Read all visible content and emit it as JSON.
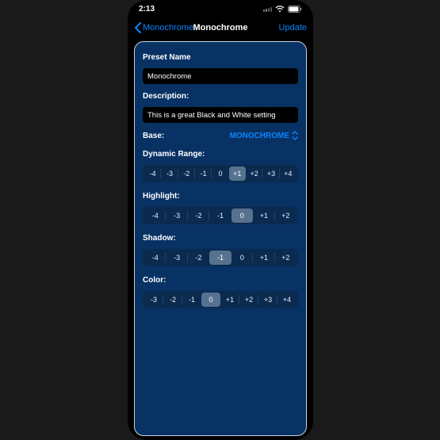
{
  "status": {
    "time": "2:13"
  },
  "nav": {
    "back_label": "Monochrome",
    "title": "Monochrome",
    "action": "Update"
  },
  "labels": {
    "preset_name": "Preset Name",
    "description": "Description:",
    "base": "Base:",
    "dynamic_range": "Dynamic Range:",
    "highlight": "Highlight:",
    "shadow": "Shadow:",
    "color": "Color:"
  },
  "fields": {
    "preset_name": "Monochrome",
    "description": "This is a great Black and White setting"
  },
  "base": {
    "value": "MONOCHROME"
  },
  "dynamic_range": {
    "options": [
      "-4",
      "-3",
      "-2",
      "-1",
      "0",
      "+1",
      "+2",
      "+3",
      "+4"
    ],
    "selected": "+1"
  },
  "highlight": {
    "options": [
      "-4",
      "-3",
      "-2",
      "-1",
      "0",
      "+1",
      "+2"
    ],
    "selected": "0"
  },
  "shadow": {
    "options": [
      "-4",
      "-3",
      "-2",
      "-1",
      "0",
      "+1",
      "+2"
    ],
    "selected": "-1"
  },
  "color": {
    "options": [
      "-3",
      "-2",
      "-1",
      "0",
      "+1",
      "+2",
      "+3",
      "+4"
    ],
    "selected": "0"
  },
  "accent": "#0a84ff"
}
